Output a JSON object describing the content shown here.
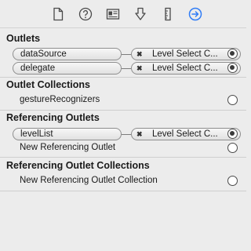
{
  "toolbar": {
    "icons": [
      "file-inspector-icon",
      "quick-help-icon",
      "identity-inspector-icon",
      "attributes-inspector-icon",
      "size-inspector-icon",
      "connections-inspector-icon"
    ],
    "selected_color": "#2f7cf6"
  },
  "sections": {
    "outlets": {
      "title": "Outlets",
      "rows": [
        {
          "name": "dataSource",
          "target": "Level Select C..."
        },
        {
          "name": "delegate",
          "target": "Level Select C..."
        }
      ]
    },
    "outlet_collections": {
      "title": "Outlet Collections",
      "rows": [
        {
          "name": "gestureRecognizers"
        }
      ]
    },
    "referencing_outlets": {
      "title": "Referencing Outlets",
      "rows": [
        {
          "name": "levelList",
          "target": "Level Select C..."
        },
        {
          "name": "New Referencing Outlet"
        }
      ]
    },
    "referencing_outlet_collections": {
      "title": "Referencing Outlet Collections",
      "rows": [
        {
          "name": "New Referencing Outlet Collection"
        }
      ]
    }
  }
}
